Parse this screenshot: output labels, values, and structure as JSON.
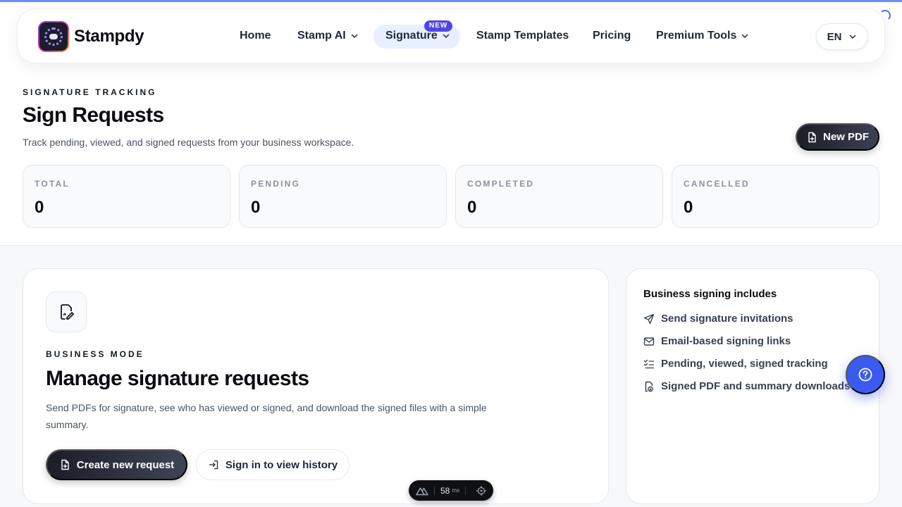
{
  "brand": {
    "name": "Stampdy"
  },
  "nav": {
    "home": "Home",
    "stamp_ai": "Stamp AI",
    "signature": "Signature",
    "signature_badge": "NEW",
    "stamp_templates": "Stamp Templates",
    "pricing": "Pricing",
    "premium_tools": "Premium Tools",
    "language": "EN"
  },
  "header": {
    "eyebrow": "SIGNATURE TRACKING",
    "title": "Sign Requests",
    "subtitle": "Track pending, viewed, and signed requests from your business workspace.",
    "new_pdf_button": "New PDF"
  },
  "stats": [
    {
      "label": "TOTAL",
      "value": "0"
    },
    {
      "label": "PENDING",
      "value": "0"
    },
    {
      "label": "COMPLETED",
      "value": "0"
    },
    {
      "label": "CANCELLED",
      "value": "0"
    }
  ],
  "main_card": {
    "eyebrow": "BUSINESS MODE",
    "title": "Manage signature requests",
    "description": "Send PDFs for signature, see who has viewed or signed, and download the signed files with a simple summary.",
    "create_button": "Create new request",
    "signin_button": "Sign in to view history"
  },
  "side_card": {
    "title": "Business signing includes",
    "features": [
      {
        "label": "Send signature invitations",
        "icon": "send-icon"
      },
      {
        "label": "Email-based signing links",
        "icon": "mail-icon"
      },
      {
        "label": "Pending, viewed, signed tracking",
        "icon": "list-checks-icon"
      },
      {
        "label": "Signed PDF and summary downloads",
        "icon": "file-download-icon"
      }
    ]
  },
  "devtools": {
    "ms": "58",
    "unit": "ms"
  },
  "colors": {
    "accent": "#4f46e5",
    "fab": "#3b5bf0",
    "dark_button": "#1b1d27"
  }
}
